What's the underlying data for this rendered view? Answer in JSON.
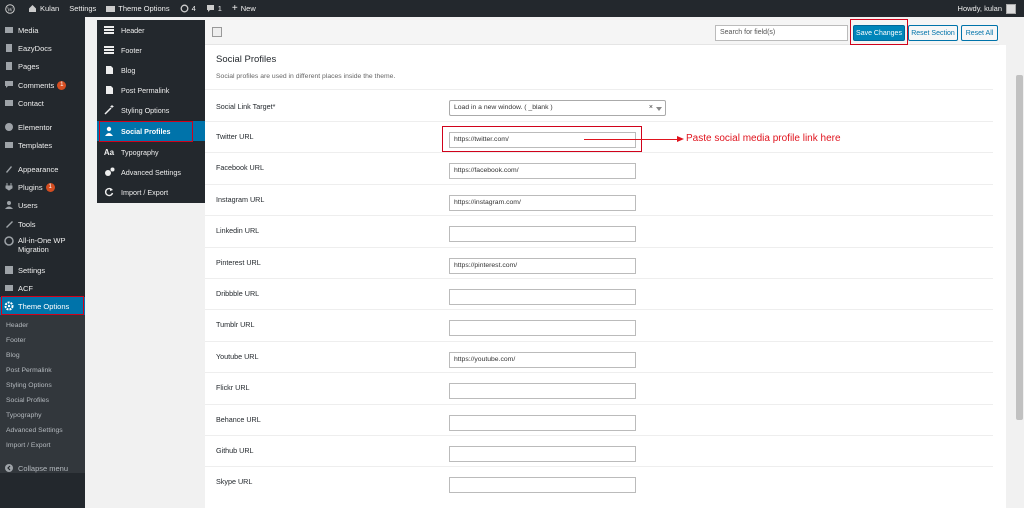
{
  "admin_bar": {
    "site_name": "Kulan",
    "settings": "Settings",
    "theme_options": "Theme Options",
    "updates_count": "4",
    "comments_count": "1",
    "new_label": "New",
    "howdy": "Howdy, kulan"
  },
  "admin_menu": {
    "items": [
      {
        "label": "Media",
        "icon": "media-icon"
      },
      {
        "label": "EazyDocs",
        "icon": "docs-icon"
      },
      {
        "label": "Pages",
        "icon": "pages-icon"
      },
      {
        "label": "Comments",
        "icon": "comments-icon",
        "badge": "1"
      },
      {
        "label": "Contact",
        "icon": "mail-icon"
      },
      {
        "label": "Elementor",
        "icon": "elementor-icon"
      },
      {
        "label": "Templates",
        "icon": "folder-icon"
      },
      {
        "label": "Appearance",
        "icon": "brush-icon"
      },
      {
        "label": "Plugins",
        "icon": "plug-icon",
        "badge": "1"
      },
      {
        "label": "Users",
        "icon": "user-icon"
      },
      {
        "label": "Tools",
        "icon": "wrench-icon"
      },
      {
        "label": "All-in-One WP",
        "label2": "Migration",
        "icon": "migration-icon"
      },
      {
        "label": "Settings",
        "icon": "settings-icon"
      },
      {
        "label": "ACF",
        "icon": "acf-icon"
      },
      {
        "label": "Theme Options",
        "icon": "gear-icon"
      }
    ],
    "submenu": [
      "Header",
      "Footer",
      "Blog",
      "Post Permalink",
      "Styling Options",
      "Social Profiles",
      "Typography",
      "Advanced Settings",
      "Import / Export"
    ],
    "collapse": "Collapse menu"
  },
  "panel_menu": [
    {
      "label": "Header",
      "icon": "header-icon"
    },
    {
      "label": "Footer",
      "icon": "footer-icon"
    },
    {
      "label": "Blog",
      "icon": "blog-icon"
    },
    {
      "label": "Post Permalink",
      "icon": "permalink-icon"
    },
    {
      "label": "Styling Options",
      "icon": "magic-wand-icon"
    },
    {
      "label": "Social Profiles",
      "icon": "user-icon"
    },
    {
      "label": "Typography",
      "icon": "typography-icon"
    },
    {
      "label": "Advanced Settings",
      "icon": "cogs-icon"
    },
    {
      "label": "Import / Export",
      "icon": "refresh-icon"
    }
  ],
  "toolbar": {
    "search_placeholder": "Search for field(s)",
    "save": "Save Changes",
    "reset_section": "Reset Section",
    "reset_all": "Reset All"
  },
  "section": {
    "title": "Social Profiles",
    "description": "Social profiles are used in different places inside the theme."
  },
  "link_target": {
    "label": "Social Link Target*",
    "value": "Load in a new window. ( _blank )"
  },
  "fields": [
    {
      "label": "Twitter URL",
      "value": "https://twitter.com/"
    },
    {
      "label": "Facebook URL",
      "value": "https://facebook.com/"
    },
    {
      "label": "Instagram URL",
      "value": "https://instagram.com/"
    },
    {
      "label": "Linkedin URL",
      "value": ""
    },
    {
      "label": "Pinterest URL",
      "value": "https://pinterest.com/"
    },
    {
      "label": "Dribbble URL",
      "value": ""
    },
    {
      "label": "Tumblr URL",
      "value": ""
    },
    {
      "label": "Youtube URL",
      "value": "https://youtube.com/"
    },
    {
      "label": "Flickr URL",
      "value": ""
    },
    {
      "label": "Behance URL",
      "value": ""
    },
    {
      "label": "Github URL",
      "value": ""
    },
    {
      "label": "Skype URL",
      "value": ""
    }
  ],
  "annotation": "Paste social media profile link here",
  "colors": {
    "admin_dark": "#23282d",
    "accent": "#0073aa",
    "annotation_red": "#e0141e"
  }
}
